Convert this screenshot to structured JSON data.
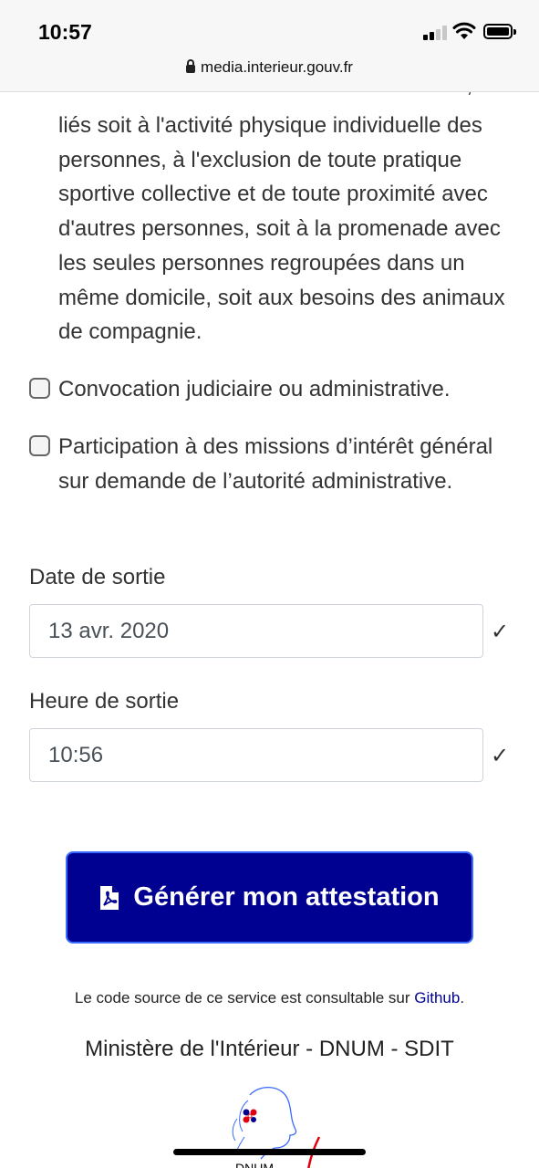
{
  "status_bar": {
    "time": "10:57"
  },
  "browser": {
    "url": "media.interieur.gouv.fr"
  },
  "form": {
    "motif_fragment_cut": "maximal d'un kilomètre autour du domicile,",
    "motif_fragment": "liés soit à l'activité physique individuelle des personnes, à l'exclusion de toute pratique sportive collective et de toute proximité avec d'autres personnes, soit à la promenade avec les seules personnes regroupées dans un même domicile, soit aux besoins des animaux de compagnie.",
    "reasons": [
      {
        "label": "Convocation judiciaire ou administrative.",
        "checked": false
      },
      {
        "label": "Participation à des missions d’intérêt général sur demande de l’autorité administrative.",
        "checked": false
      }
    ],
    "date_label": "Date de sortie",
    "date_value": "13 avr. 2020",
    "time_label": "Heure de sortie",
    "time_value": "10:56",
    "valid_mark": "✓",
    "submit_label": "Générer mon attestation"
  },
  "footer": {
    "source_text": "Le code source de ce service est consultable sur ",
    "source_link": "Github",
    "source_end": ".",
    "ministry": "Ministère de l'Intérieur - DNUM - SDIT",
    "logo_text": "DNUM"
  },
  "colors": {
    "primary": "#000091",
    "button_border": "#3a6bff",
    "text": "#333333"
  },
  "icons": [
    "lock-icon",
    "signal-icon",
    "wifi-icon",
    "battery-icon",
    "pdf-file-icon",
    "checkmark-icon"
  ]
}
